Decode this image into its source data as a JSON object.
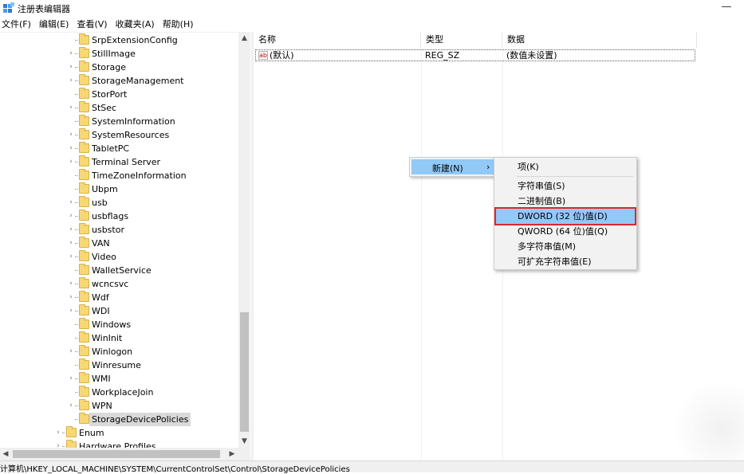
{
  "window": {
    "title": "注册表编辑器",
    "minimize_glyph": "—"
  },
  "menu": [
    "文件(F)",
    "编辑(E)",
    "查看(V)",
    "收藏夹(A)",
    "帮助(H)"
  ],
  "tree": {
    "items": [
      {
        "label": "SrpExtensionConfig",
        "expandable": false
      },
      {
        "label": "StillImage",
        "expandable": true
      },
      {
        "label": "Storage",
        "expandable": true
      },
      {
        "label": "StorageManagement",
        "expandable": true
      },
      {
        "label": "StorPort",
        "expandable": false
      },
      {
        "label": "StSec",
        "expandable": true
      },
      {
        "label": "SystemInformation",
        "expandable": false
      },
      {
        "label": "SystemResources",
        "expandable": true
      },
      {
        "label": "TabletPC",
        "expandable": true
      },
      {
        "label": "Terminal Server",
        "expandable": true
      },
      {
        "label": "TimeZoneInformation",
        "expandable": false
      },
      {
        "label": "Ubpm",
        "expandable": false
      },
      {
        "label": "usb",
        "expandable": true
      },
      {
        "label": "usbflags",
        "expandable": true
      },
      {
        "label": "usbstor",
        "expandable": true
      },
      {
        "label": "VAN",
        "expandable": true
      },
      {
        "label": "Video",
        "expandable": true
      },
      {
        "label": "WalletService",
        "expandable": false
      },
      {
        "label": "wcncsvc",
        "expandable": true
      },
      {
        "label": "Wdf",
        "expandable": true
      },
      {
        "label": "WDI",
        "expandable": true
      },
      {
        "label": "Windows",
        "expandable": false
      },
      {
        "label": "WinInit",
        "expandable": false
      },
      {
        "label": "Winlogon",
        "expandable": true
      },
      {
        "label": "Winresume",
        "expandable": false
      },
      {
        "label": "WMI",
        "expandable": true
      },
      {
        "label": "WorkplaceJoin",
        "expandable": false
      },
      {
        "label": "WPN",
        "expandable": true
      },
      {
        "label": "StorageDevicePolicies",
        "expandable": false,
        "selected": true
      }
    ],
    "parent_items": [
      {
        "label": "Enum",
        "expandable": true
      },
      {
        "label": "Hardware Profiles",
        "expandable": true
      }
    ]
  },
  "list": {
    "columns": {
      "name": "名称",
      "type": "类型",
      "data": "数据"
    },
    "rows": [
      {
        "icon": "ab",
        "name": "(默认)",
        "type": "REG_SZ",
        "data": "(数值未设置)"
      }
    ]
  },
  "context_menu": {
    "item_label": "新建(N)",
    "arrow": "›"
  },
  "submenu": {
    "items": [
      "项(K)",
      "字符串值(S)",
      "二进制值(B)",
      "DWORD (32 位)值(D)",
      "QWORD (64 位)值(Q)",
      "多字符串值(M)",
      "可扩充字符串值(E)"
    ],
    "highlighted_index": 3
  },
  "status": {
    "path": "计算机\\HKEY_LOCAL_MACHINE\\SYSTEM\\CurrentControlSet\\Control\\StorageDevicePolicies"
  },
  "colors": {
    "selection_blue": "#91c9f7",
    "highlight_border": "#e0262b",
    "folder_yellow": "#f8d775"
  }
}
